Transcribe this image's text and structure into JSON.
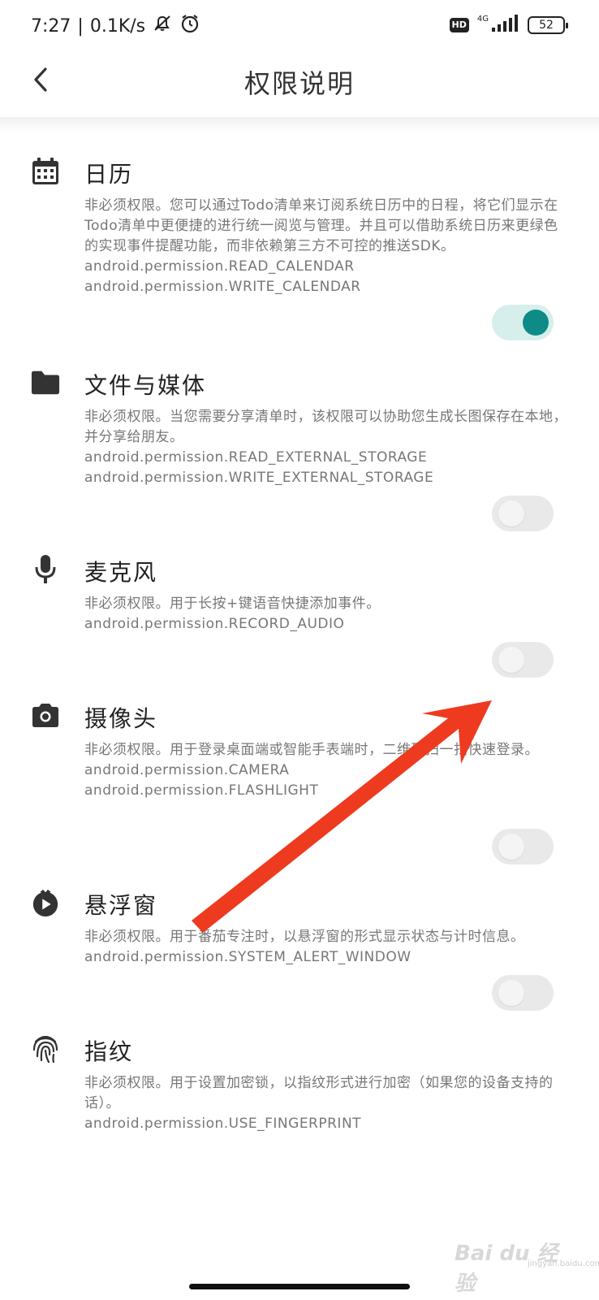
{
  "status_bar": {
    "time": "7:27",
    "net_speed": "0.1K/s",
    "hd": "HD",
    "network": "4G",
    "battery": "52"
  },
  "header": {
    "title": "权限说明"
  },
  "permissions": [
    {
      "title": "日历",
      "icon": "calendar-icon",
      "description": "非必须权限。您可以通过Todo清单来订阅系统日历中的日程，将它们显示在Todo清单中更便捷的进行统一阅览与管理。并且可以借助系统日历来更绿色的实现事件提醒功能，而非依赖第三方不可控的推送SDK。",
      "perm1": "android.permission.READ_CALENDAR",
      "perm2": "android.permission.WRITE_CALENDAR",
      "enabled": true
    },
    {
      "title": "文件与媒体",
      "icon": "folder-icon",
      "description": "非必须权限。当您需要分享清单时，该权限可以协助您生成长图保存在本地，并分享给朋友。",
      "perm1": "android.permission.READ_EXTERNAL_STORAGE",
      "perm2": "android.permission.WRITE_EXTERNAL_STORAGE",
      "enabled": false
    },
    {
      "title": "麦克风",
      "icon": "microphone-icon",
      "description": "非必须权限。用于长按+键语音快捷添加事件。",
      "perm1": "android.permission.RECORD_AUDIO",
      "enabled": false
    },
    {
      "title": "摄像头",
      "icon": "camera-icon",
      "description": "非必须权限。用于登录桌面端或智能手表端时，二维码扫一扫快速登录。",
      "perm1": "android.permission.CAMERA",
      "perm2": "android.permission.FLASHLIGHT",
      "enabled": false
    },
    {
      "title": "悬浮窗",
      "icon": "timer-play-icon",
      "description": "非必须权限。用于番茄专注时，以悬浮窗的形式显示状态与计时信息。",
      "perm1": "android.permission.SYSTEM_ALERT_WINDOW",
      "enabled": false
    },
    {
      "title": "指纹",
      "icon": "fingerprint-icon",
      "description": "非必须权限。用于设置加密锁，以指纹形式进行加密（如果您的设备支持的话）。",
      "perm1": "android.permission.USE_FINGERPRINT"
    }
  ],
  "watermark": {
    "brand": "Bai du 经验",
    "url": "jingyan.baidu.com"
  },
  "colors": {
    "toggle_on": "#0e8b86",
    "toggle_on_track": "#d6eeec",
    "toggle_off_track": "#e9e9e9",
    "annotation_arrow": "#ee3a1f"
  }
}
